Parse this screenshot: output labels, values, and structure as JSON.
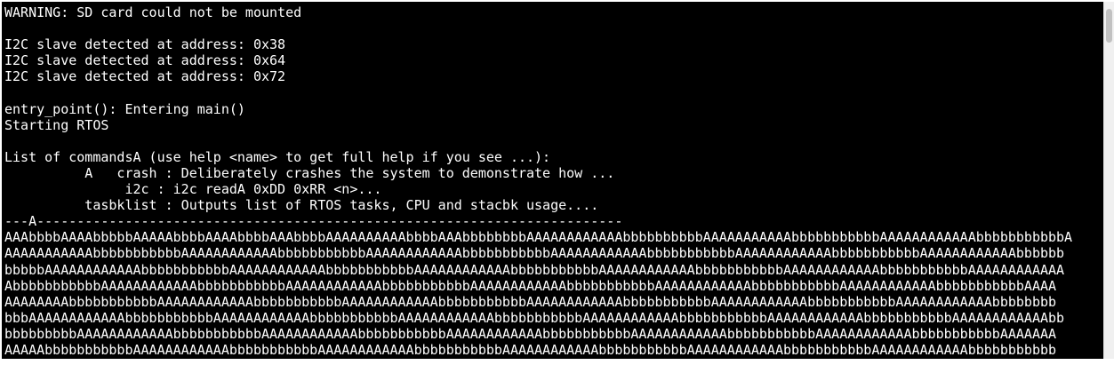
{
  "terminal": {
    "lines": [
      "WARNING: SD card could not be mounted",
      "",
      "I2C slave detected at address: 0x38",
      "I2C slave detected at address: 0x64",
      "I2C slave detected at address: 0x72",
      "",
      "entry_point(): Entering main()",
      "Starting RTOS",
      "",
      "List of commandsA (use help <name> to get full help if you see ...):",
      "          A   crash : Deliberately crashes the system to demonstrate how ...",
      "               i2c : i2c readA 0xDD 0xRR <n>...",
      "          tasbklist : Outputs list of RTOS tasks, CPU and stacbk usage....",
      "---A-------------------------------------------------------------------------",
      "AAAbbbbAAAAbbbbbAAAAAbbbbAAAAbbbbAAAbbbbAAAAAAAAAAbbbbAAAbbbbbbbbAAAAAAAAAAAAbbbbbbbbbbAAAAAAAAAAAbbbbbbbbbbbAAAAAAAAAAAAbbbbbbbbbbbA",
      "AAAAAAAAAAAbbbbbbbbbbbAAAAAAAAAAAAbbbbbbbbbbbAAAAAAAAAAAAbbbbbbbbbbbAAAAAAAAAAAAbbbbbbbbbbbAAAAAAAAAAAAbbbbbbbbbbbAAAAAAAAAAAAbbbbbb",
      "bbbbbAAAAAAAAAAAAbbbbbbbbbbbAAAAAAAAAAAAbbbbbbbbbbbAAAAAAAAAAAAbbbbbbbbbbbAAAAAAAAAAAAbbbbbbbbbbbAAAAAAAAAAAAbbbbbbbbbbbAAAAAAAAAAAA",
      "AbbbbbbbbbbbAAAAAAAAAAAAbbbbbbbbbbbAAAAAAAAAAAAbbbbbbbbbbbAAAAAAAAAAAAbbbbbbbbbbbAAAAAAAAAAAAbbbbbbbbbbbAAAAAAAAAAAAbbbbbbbbbbbAAAA",
      "AAAAAAAAbbbbbbbbbbbAAAAAAAAAAAAbbbbbbbbbbbAAAAAAAAAAAAbbbbbbbbbbbAAAAAAAAAAAAbbbbbbbbbbbAAAAAAAAAAAAbbbbbbbbbbbAAAAAAAAAAAAbbbbbbbb",
      "bbbAAAAAAAAAAAAbbbbbbbbbbbAAAAAAAAAAAAbbbbbbbbbbbAAAAAAAAAAAAbbbbbbbbbbbAAAAAAAAAAAAbbbbbbbbbbbAAAAAAAAAAAAbbbbbbbbbbbAAAAAAAAAAAAbb",
      "bbbbbbbbbAAAAAAAAAAAAbbbbbbbbbbbAAAAAAAAAAAAbbbbbbbbbbbAAAAAAAAAAAAbbbbbbbbbbbAAAAAAAAAAAAbbbbbbbbbbbAAAAAAAAAAAAbbbbbbbbbbbAAAAAAA",
      "AAAAAbbbbbbbbbbbAAAAAAAAAAAAbbbbbbbbbbbAAAAAAAAAAAAbbbbbbbbbbbAAAAAAAAAAAAbbbbbbbbbbbAAAAAAAAAAAAbbbbbbbbbbbAAAAAAAAAAAAbbbbbbbbbbb"
    ]
  },
  "scrollbar": {
    "position_fraction": 0.02
  }
}
